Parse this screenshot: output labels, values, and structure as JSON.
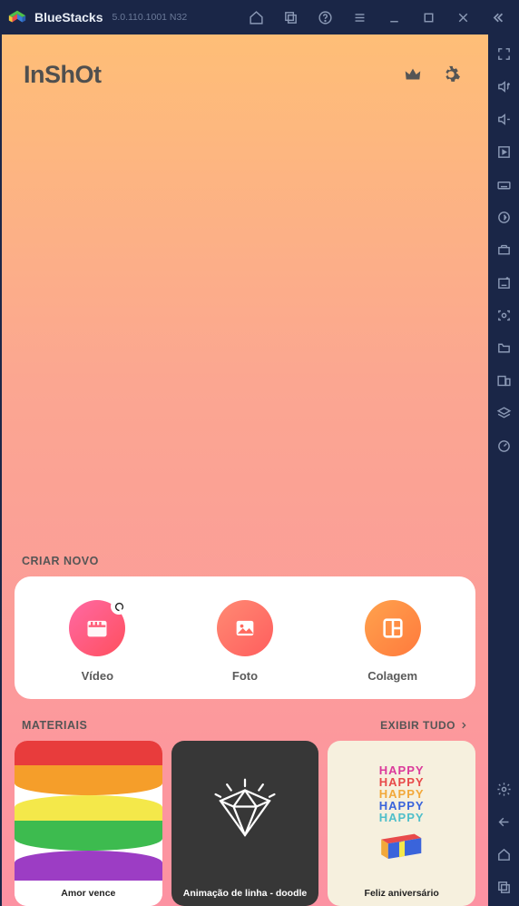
{
  "emulator": {
    "name": "BlueStacks",
    "version": "5.0.110.1001 N32"
  },
  "app": {
    "logo_text": "InShOt"
  },
  "create": {
    "section_label": "CRIAR NOVO",
    "video_label": "Vídeo",
    "photo_label": "Foto",
    "collage_label": "Colagem"
  },
  "materials": {
    "section_label": "MATERIAIS",
    "show_all_label": "EXIBIR TUDO",
    "items": [
      {
        "label": "Amor vence"
      },
      {
        "label": "Animação de linha - doodle"
      },
      {
        "label": "Feliz aniversário"
      }
    ],
    "happy_word": "HAPPY"
  }
}
